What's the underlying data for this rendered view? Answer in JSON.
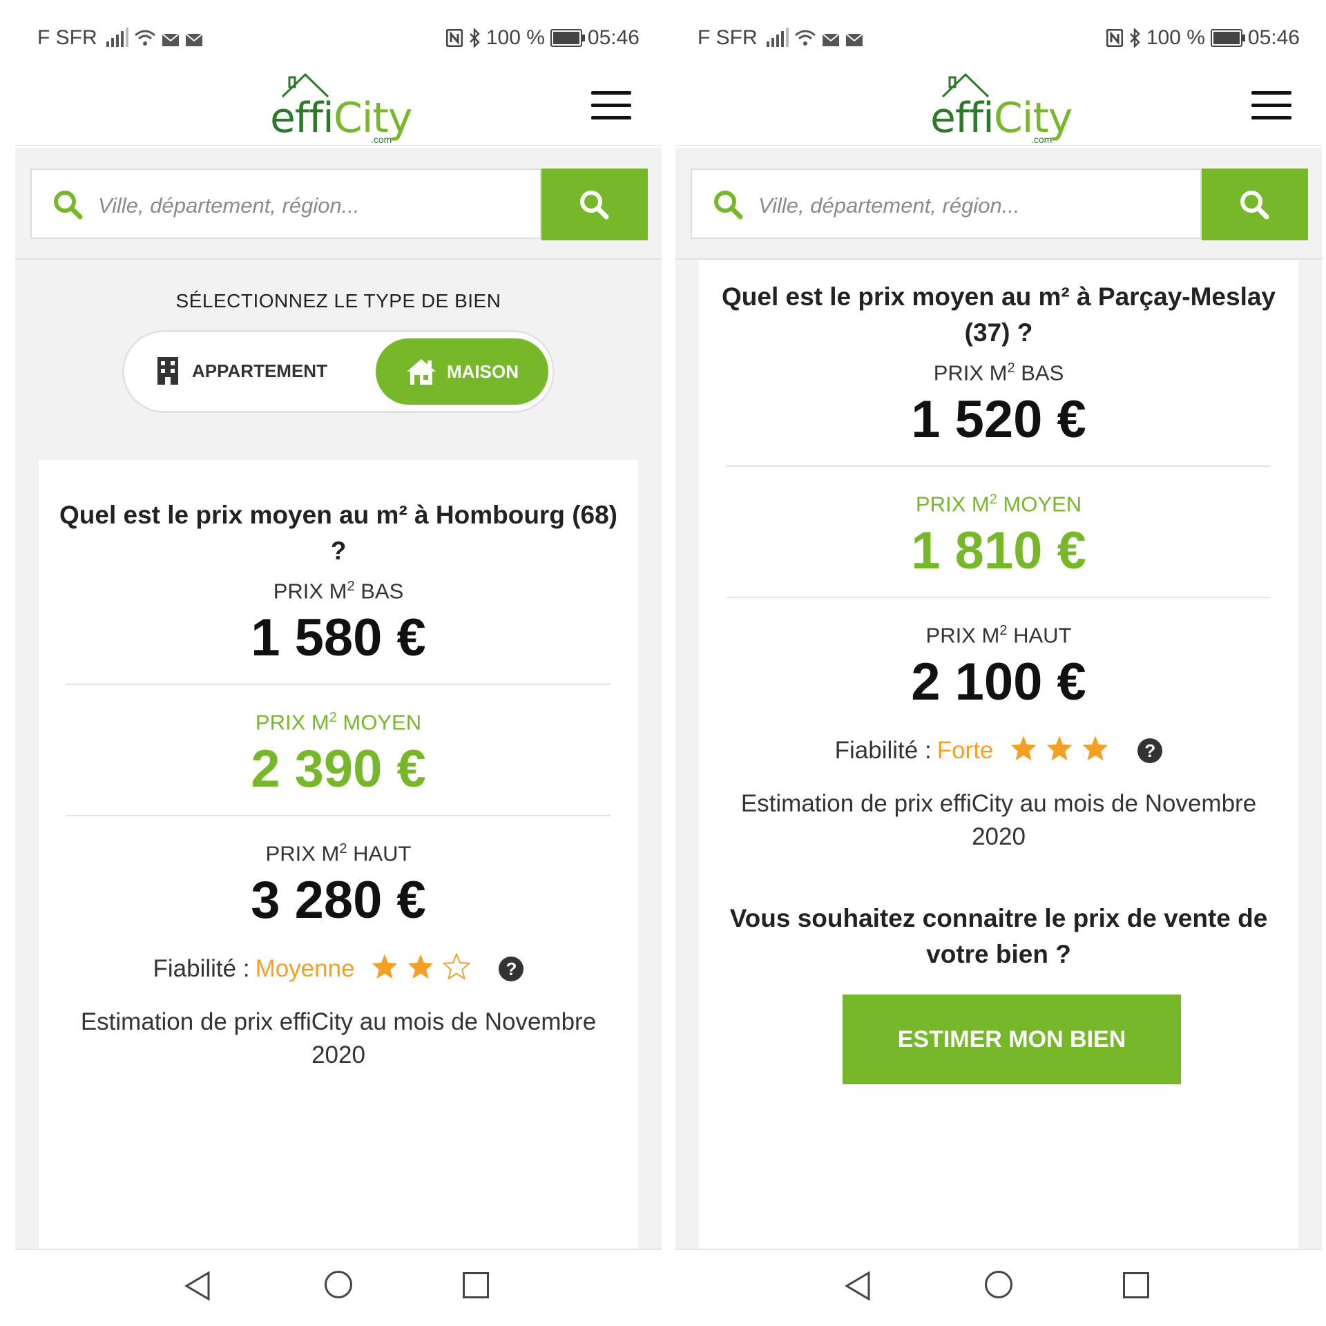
{
  "screens": [
    {
      "status": {
        "carrier": "F SFR",
        "battery": "100 %",
        "time": "05:46"
      },
      "header": {
        "logo_effi": "effi",
        "logo_city": "City",
        "logo_com": ".com"
      },
      "search": {
        "placeholder": "Ville, département, région..."
      },
      "type_selector": {
        "title": "SÉLECTIONNEZ LE TYPE DE BIEN",
        "option_apartment": "APPARTEMENT",
        "option_house": "MAISON",
        "selected": "MAISON"
      },
      "question": "Quel est le prix moyen au m² à Hombourg (68) ?",
      "prix_bas": {
        "label_prefix": "PRIX M",
        "label_sup": "2",
        "label_suffix": " BAS",
        "value": "1 580 €"
      },
      "prix_moyen": {
        "label_prefix": "PRIX M",
        "label_sup": "2",
        "label_suffix": " MOYEN",
        "value": "2 390 €"
      },
      "prix_haut": {
        "label_prefix": "PRIX M",
        "label_sup": "2",
        "label_suffix": " HAUT",
        "value": "3 280 €"
      },
      "fiabilite": {
        "label": "Fiabilité :",
        "level": "Moyenne",
        "stars": 2,
        "max_stars": 3,
        "help": "?"
      },
      "estimation": "Estimation de prix effiCity au mois de Novembre 2020"
    },
    {
      "status": {
        "carrier": "F SFR",
        "battery": "100 %",
        "time": "05:46"
      },
      "header": {
        "logo_effi": "effi",
        "logo_city": "City",
        "logo_com": ".com"
      },
      "search": {
        "placeholder": "Ville, département, région..."
      },
      "question": "Quel est le prix moyen au m² à Parçay-Meslay (37) ?",
      "prix_bas": {
        "label_prefix": "PRIX M",
        "label_sup": "2",
        "label_suffix": " BAS",
        "value": "1 520 €"
      },
      "prix_moyen": {
        "label_prefix": "PRIX M",
        "label_sup": "2",
        "label_suffix": " MOYEN",
        "value": "1 810 €"
      },
      "prix_haut": {
        "label_prefix": "PRIX M",
        "label_sup": "2",
        "label_suffix": " HAUT",
        "value": "2 100 €"
      },
      "fiabilite": {
        "label": "Fiabilité :",
        "level": "Forte",
        "stars": 3,
        "max_stars": 3,
        "help": "?"
      },
      "estimation": "Estimation de prix effiCity au mois de Novembre 2020",
      "cta": {
        "question": "Vous souhaitez connaitre le prix de vente de votre bien ?",
        "button": "ESTIMER MON BIEN"
      }
    }
  ],
  "colors": {
    "brand_green": "#76b82a",
    "dark_green": "#2a7a2a",
    "star_orange": "#f3a024"
  }
}
